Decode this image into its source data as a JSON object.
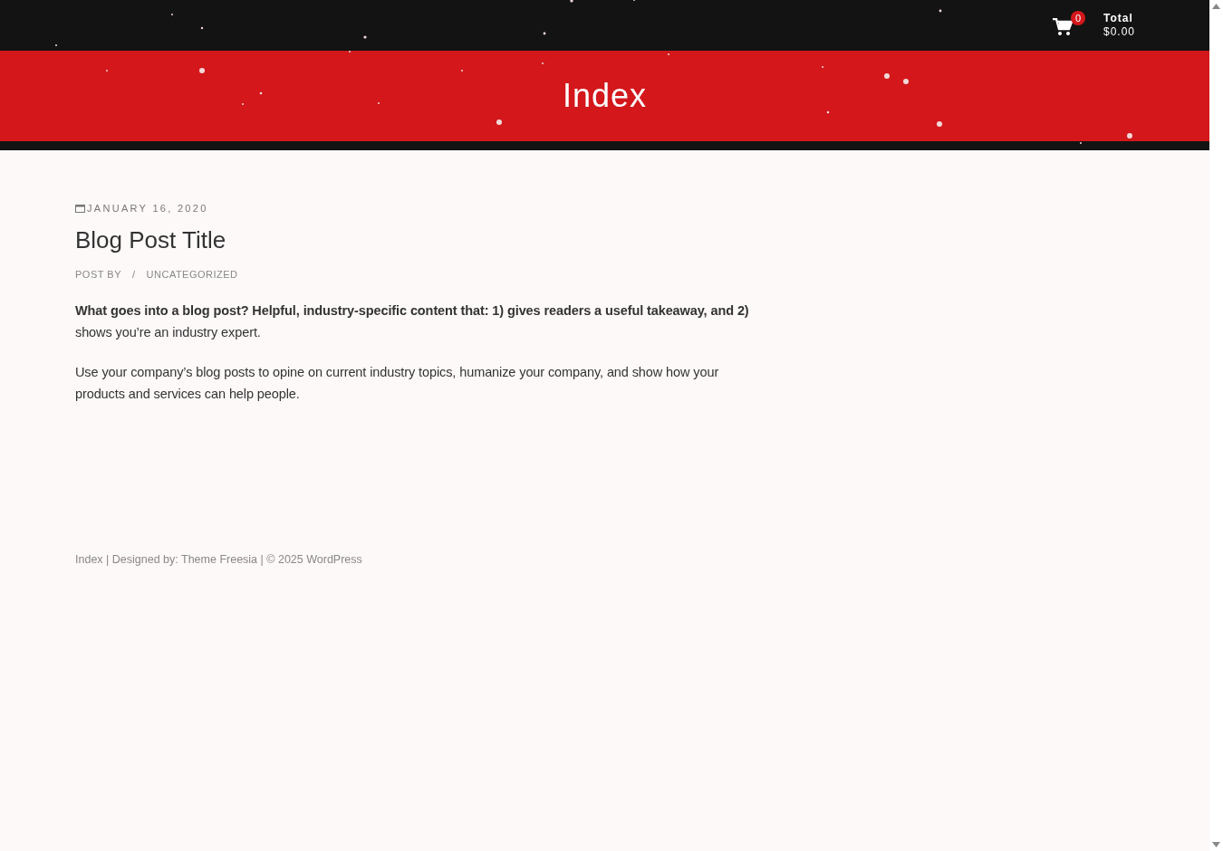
{
  "header": {
    "cart": {
      "count": "0",
      "total_label": "Total",
      "total_value": "$0.00"
    }
  },
  "banner": {
    "title": "Index"
  },
  "post": {
    "date": "JANUARY 16, 2020",
    "title": "Blog Post Title",
    "meta": {
      "author_label": "POST BY",
      "separator": "/",
      "category": "UNCATEGORIZED"
    },
    "paragraphs": [
      "**What goes into a blog post? Helpful, industry-specific content that: 1) gives readers a useful takeaway, and 2)** shows you’re an industry expert.",
      "Use your company’s blog posts to opine on current industry topics, humanize your company, and show how your products and services can help people."
    ]
  },
  "footer": {
    "site_link": "Index",
    "designed_by": "| Designed by:",
    "designer_link": "Theme Freesia",
    "copyright": "| © 2025",
    "platform_link": "WordPress"
  }
}
